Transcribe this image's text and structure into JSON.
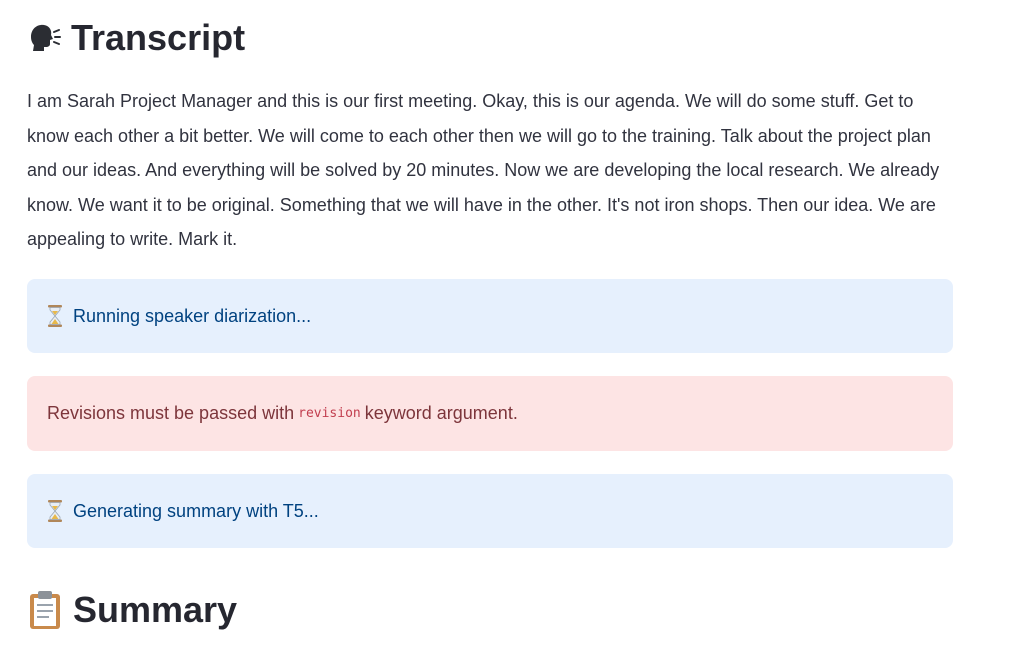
{
  "transcript": {
    "icon": "speaking-head-icon",
    "title": "Transcript",
    "text": "I am Sarah Project Manager and this is our first meeting. Okay, this is our agenda. We will do some stuff. Get to know each other a bit better. We will come to each other then we will go to the training. Talk about the project plan and our ideas. And everything will be solved by 20 minutes. Now we are developing the local research. We already know. We want it to be original. Something that we will have in the other. It's not iron shops. Then our idea. We are appealing to write. Mark it."
  },
  "alerts": [
    {
      "kind": "info",
      "icon": "hourglass-icon",
      "text": "Running speaker diarization..."
    },
    {
      "kind": "error",
      "text_before": "Revisions must be passed with",
      "code": "revision",
      "text_after": "keyword argument."
    },
    {
      "kind": "info",
      "icon": "hourglass-icon",
      "text": "Generating summary with T5..."
    }
  ],
  "summary": {
    "icon": "clipboard-icon",
    "title": "Summary"
  },
  "colors": {
    "info_bg": "#e6f0fd",
    "info_text": "#004280",
    "error_bg": "#fde4e4",
    "error_text": "#7d353b",
    "code_text": "#c23e4f"
  }
}
